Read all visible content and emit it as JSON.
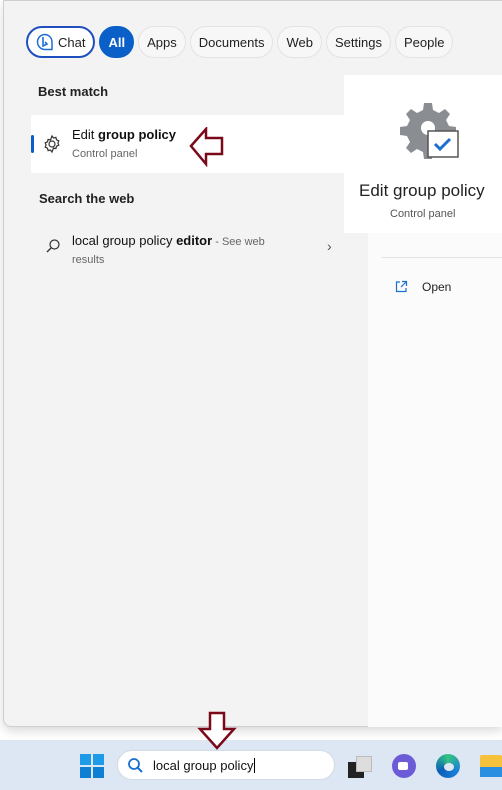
{
  "filters": [
    {
      "label": "Chat",
      "icon": "bing-chat-icon"
    },
    {
      "label": "All"
    },
    {
      "label": "Apps"
    },
    {
      "label": "Documents"
    },
    {
      "label": "Web"
    },
    {
      "label": "Settings"
    },
    {
      "label": "People"
    }
  ],
  "best_match": {
    "heading": "Best match",
    "title_plain": "Edit ",
    "title_bold": "group policy",
    "subtitle": "Control panel"
  },
  "web": {
    "heading": "Search the web",
    "query_plain": "local group policy ",
    "query_bold": "editor",
    "suffix": " - See web",
    "suffix2": "results"
  },
  "detail": {
    "title": "Edit group policy",
    "subtitle": "Control panel",
    "actions": [
      {
        "label": "Open",
        "icon": "open-external-icon"
      }
    ]
  },
  "taskbar": {
    "search_value": "local group policy"
  },
  "colors": {
    "accent": "#0a5fc8",
    "annotation_arrow": "#7a0a1a"
  }
}
